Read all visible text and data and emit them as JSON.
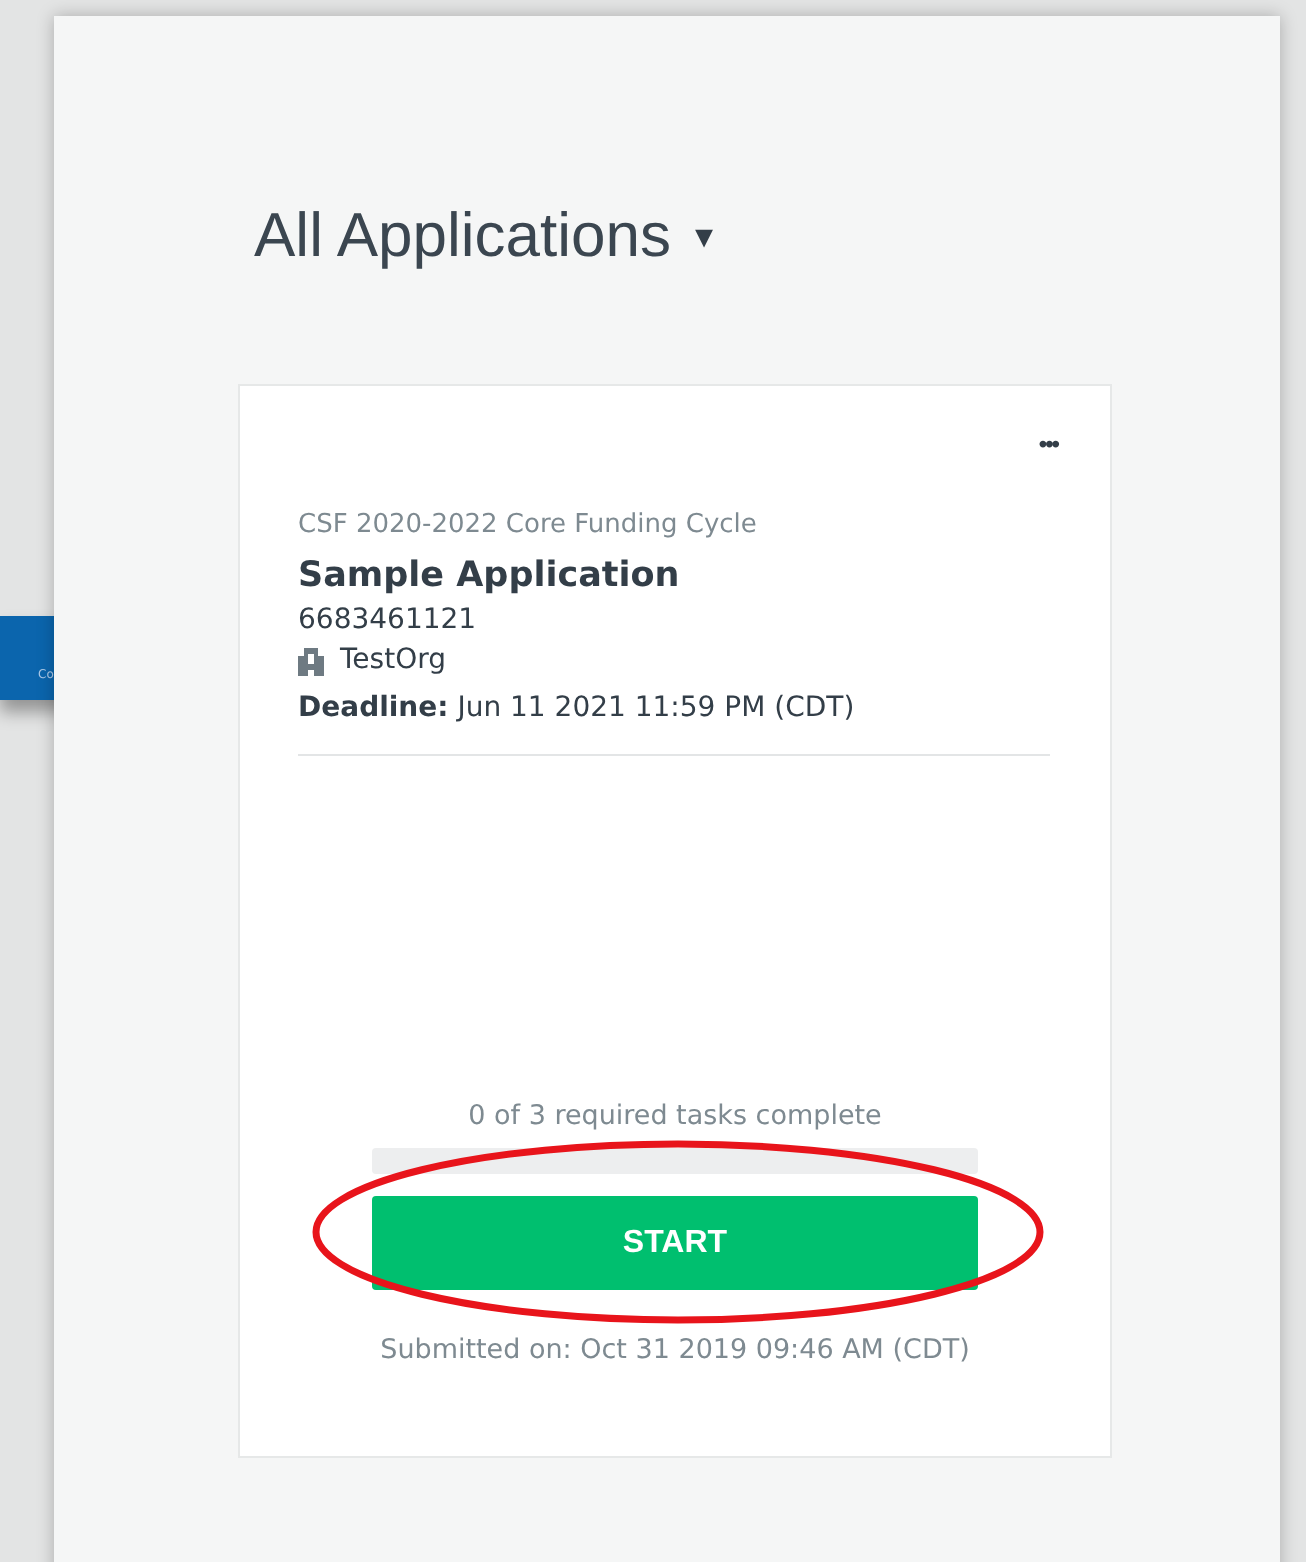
{
  "background_tab": {
    "label": "Co"
  },
  "header": {
    "title": "All Applications",
    "caret": "▾"
  },
  "card": {
    "menu": "•••",
    "cycle": "CSF 2020-2022 Core Funding Cycle",
    "name": "Sample Application",
    "number": "6683461121",
    "organization": "TestOrg",
    "deadline_label": "Deadline:",
    "deadline": "Jun 11 2021 11:59 PM (CDT)",
    "tasks": "0 of 3 required tasks complete",
    "progress": {
      "level": 0
    },
    "button": "START",
    "submitted": "Submitted on: Oct 31 2019 09:46 AM (CDT)"
  },
  "annotation": {
    "kind": "ellipse"
  }
}
